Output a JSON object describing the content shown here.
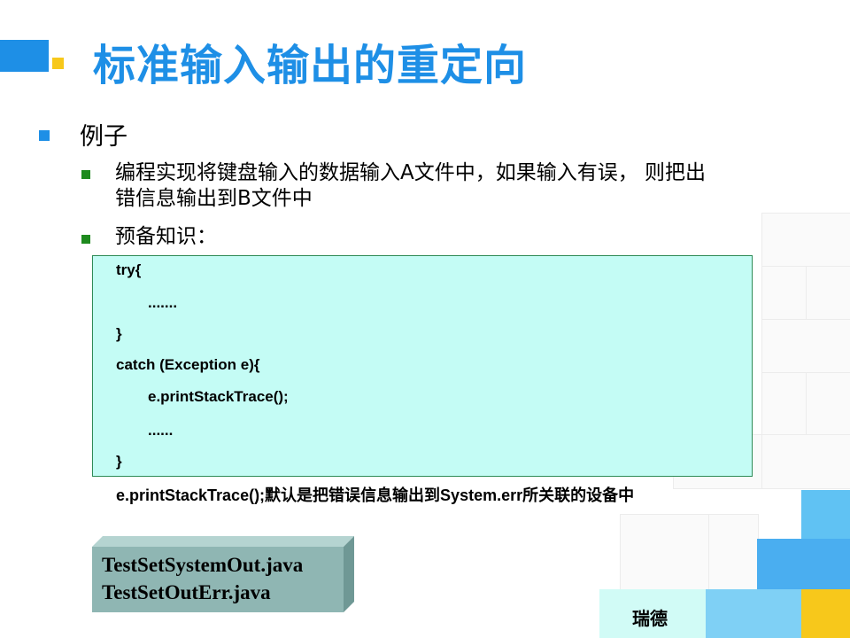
{
  "header": {
    "title": "标准输入输出的重定向",
    "accent_color": "#1e8fe6",
    "square_color": "#f7c81b"
  },
  "bullets": [
    {
      "level": 1,
      "text": "例子"
    },
    {
      "level": 2,
      "lines": [
        "编程实现将键盘输入的数据输入A文件中，如果输入有误，  则把出",
        "错信息输出到B文件中"
      ]
    },
    {
      "level": 2,
      "text": "预备知识："
    }
  ],
  "code": {
    "lines": [
      "try{",
      ".......",
      "}",
      "catch (Exception e){",
      "e.printStackTrace();",
      "......",
      "}"
    ],
    "background": "#c4fcf5"
  },
  "note": "e.printStackTrace();默认是把错误信息输出到System.err所关联的设备中",
  "files": [
    "TestSetSystemOut.java",
    "TestSetOutErr.java"
  ],
  "footer": {
    "label": "瑞德"
  }
}
